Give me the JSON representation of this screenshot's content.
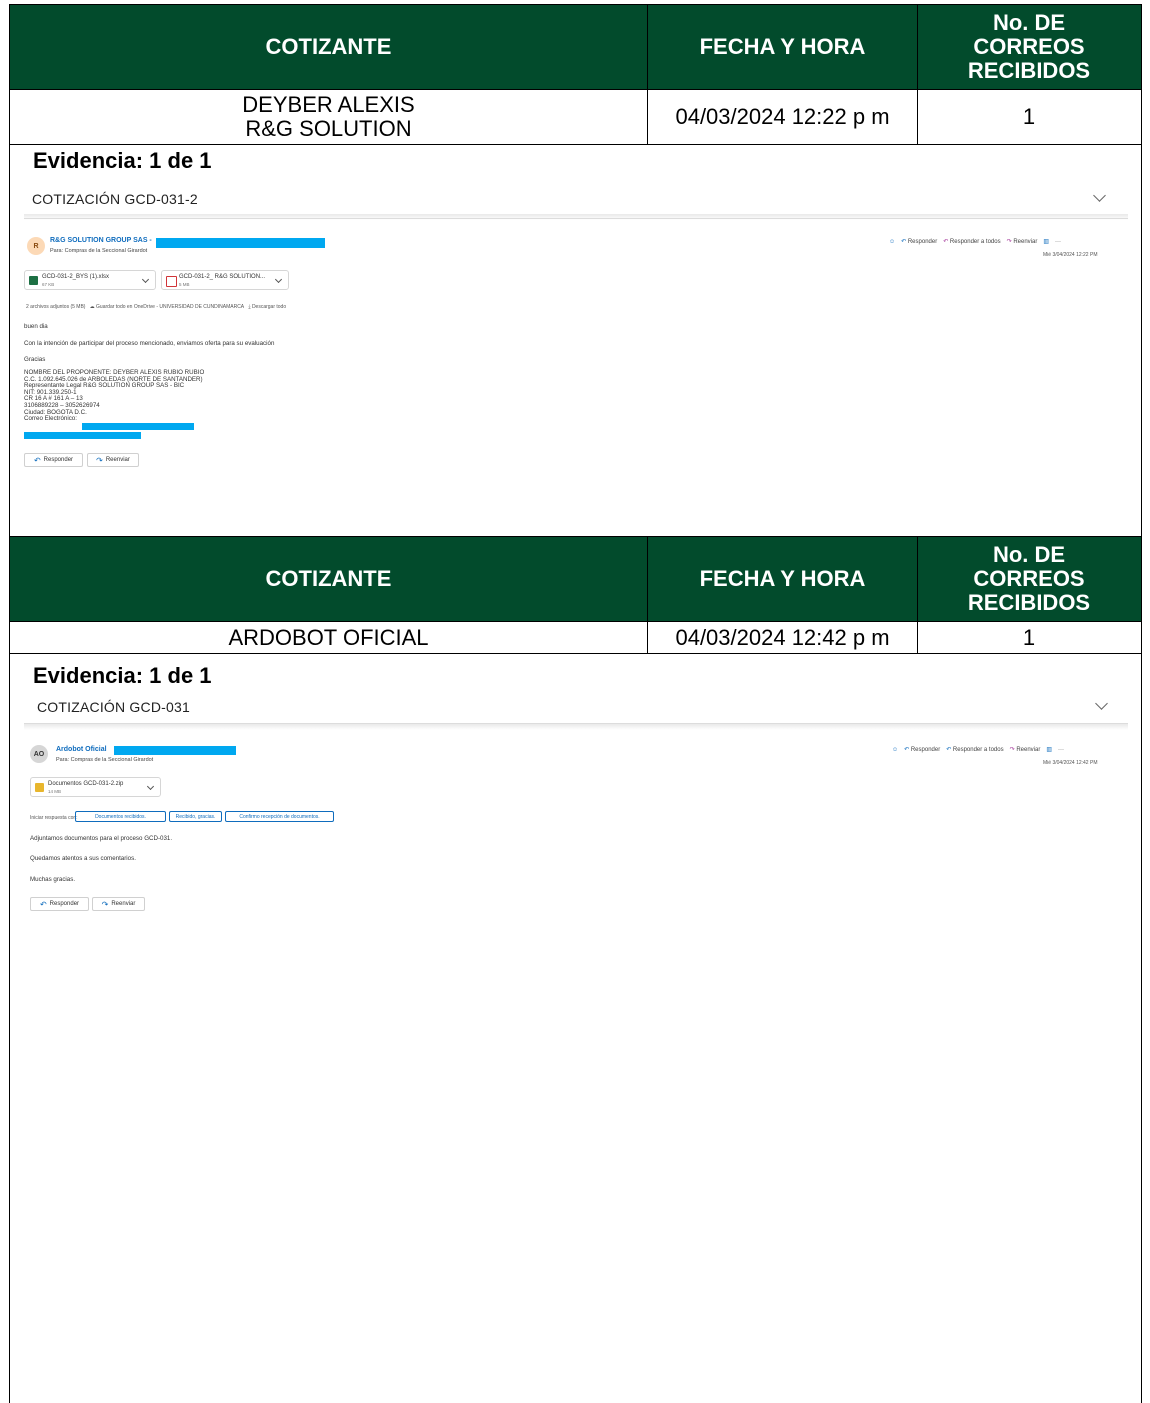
{
  "table_header": {
    "cotizante": "COTIZANTE",
    "fecha": "FECHA Y HORA",
    "correos_line1": "No. DE",
    "correos_line2": "CORREOS",
    "correos_line3": "RECIBIDOS"
  },
  "entries": [
    {
      "cotizante_line1": "DEYBER ALEXIS",
      "cotizante_line2": "R&G SOLUTION",
      "fecha": "04/03/2024  12:22 p m",
      "correos": "1",
      "evidencia": "Evidencia: 1 de 1",
      "email": {
        "subject": "COTIZACIÓN GCD-031-2",
        "avatar": "R",
        "sender": "R&G SOLUTION GROUP SAS -",
        "to": "Para:  Compras de la Seccional Girardot",
        "actions": [
          "Responder",
          "Responder a todos",
          "Reenviar"
        ],
        "date": "Mié 3/04/2024 12:22 PM",
        "attachments": [
          {
            "name": "GCD-031-2_BYS (1).xlsx",
            "size": "67 KB",
            "icon": "excel-icon"
          },
          {
            "name": "GCD-031-2_ R&G SOLUTION...",
            "size": "5 MB",
            "icon": "pdf-icon"
          }
        ],
        "attach_summary": "2 archivos adjuntos (5 MB)",
        "save_onedrive": "Guardar todo en OneDrive - UNIVERSIDAD DE CUNDINAMARCA",
        "download_all": "Descargar todo",
        "body": [
          "buen dia",
          "Con la intención de participar del proceso mencionado, enviamos oferta para su evaluación",
          "Gracias"
        ],
        "signature": [
          "NOMBRE DEL PROPONENTE: DEYBER ALEXIS RUBIO RUBIO",
          "C.C. 1.092.645.026 de ARBOLEDAS (NORTE DE SANTANDER)",
          "Representante Legal R&G SOLUTION GROUP SAS - BIC",
          "NIT: 901.339.250-1",
          "CR 16 A # 161 A – 13",
          "3106889228 – 3052626974",
          "Ciudad: BOGOTA D.C.",
          "Correo Electrónico:"
        ],
        "reply": "Responder",
        "forward": "Reenviar"
      }
    },
    {
      "cotizante_line1": "ARDOBOT OFICIAL",
      "fecha": "04/03/2024  12:42 p m",
      "correos": "1",
      "evidencia": "Evidencia: 1 de 1",
      "email": {
        "subject": "COTIZACIÓN GCD-031",
        "avatar": "AO",
        "sender": "Ardobot Oficial",
        "to": "Para:  Compras de la Seccional Girardot",
        "actions": [
          "Responder",
          "Responder a todos",
          "Reenviar"
        ],
        "date": "Mié 3/04/2024 12:42 PM",
        "attachments": [
          {
            "name": "Documentos GCD-031-2.zip",
            "size": "14 MB",
            "icon": "zip-folder-icon"
          }
        ],
        "quick_reply_label": "Iniciar respuesta con:",
        "quick_replies": [
          "Documentos recibidos.",
          "Recibido, gracias.",
          "Confirmo recepción de documentos."
        ],
        "body": [
          "Adjuntamos documentos para el proceso GCD-031.",
          "Quedamos atentos a sus comentarios.",
          "Muchas gracias."
        ],
        "reply": "Responder",
        "forward": "Reenviar"
      }
    }
  ],
  "colors": {
    "header_bg": "#024b2c",
    "redaction": "#00a8f0",
    "link": "#0f6cbd"
  }
}
